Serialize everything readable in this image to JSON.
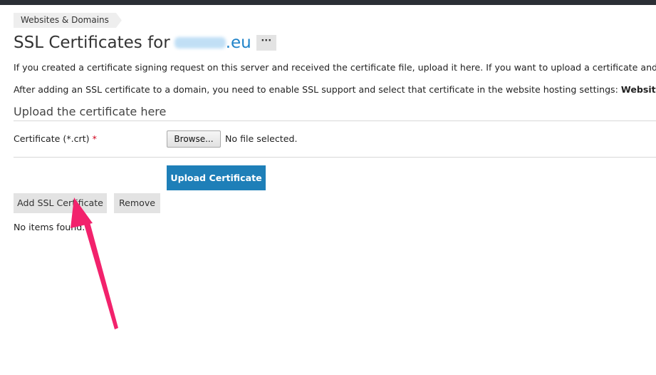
{
  "breadcrumb": {
    "label": "Websites & Domains"
  },
  "header": {
    "title_prefix": "SSL Certificates for",
    "domain_tld": ".eu",
    "more_label": "···"
  },
  "intro": {
    "line1": "If you created a certificate signing request on this server and received the certificate file, upload it here. If you want to upload a certificate and private",
    "line2_text": "After adding an SSL certificate to a domain, you need to enable SSL support and select that certificate in the website hosting settings: ",
    "line2_bold": "Websites & Dom"
  },
  "upload_section": {
    "title": "Upload the certificate here",
    "field_label": "Certificate (*.crt)",
    "required_mark": "*",
    "browse_label": "Browse...",
    "file_status": "No file selected.",
    "upload_button": "Upload Certificate"
  },
  "toolbar": {
    "add_label": "Add SSL Certificate",
    "remove_label": "Remove"
  },
  "list": {
    "empty_text": "No items found."
  },
  "colors": {
    "primary_button": "#1e7fb8",
    "link": "#1f83c9",
    "annotation_arrow": "#f2226c",
    "required": "#d0021b"
  }
}
